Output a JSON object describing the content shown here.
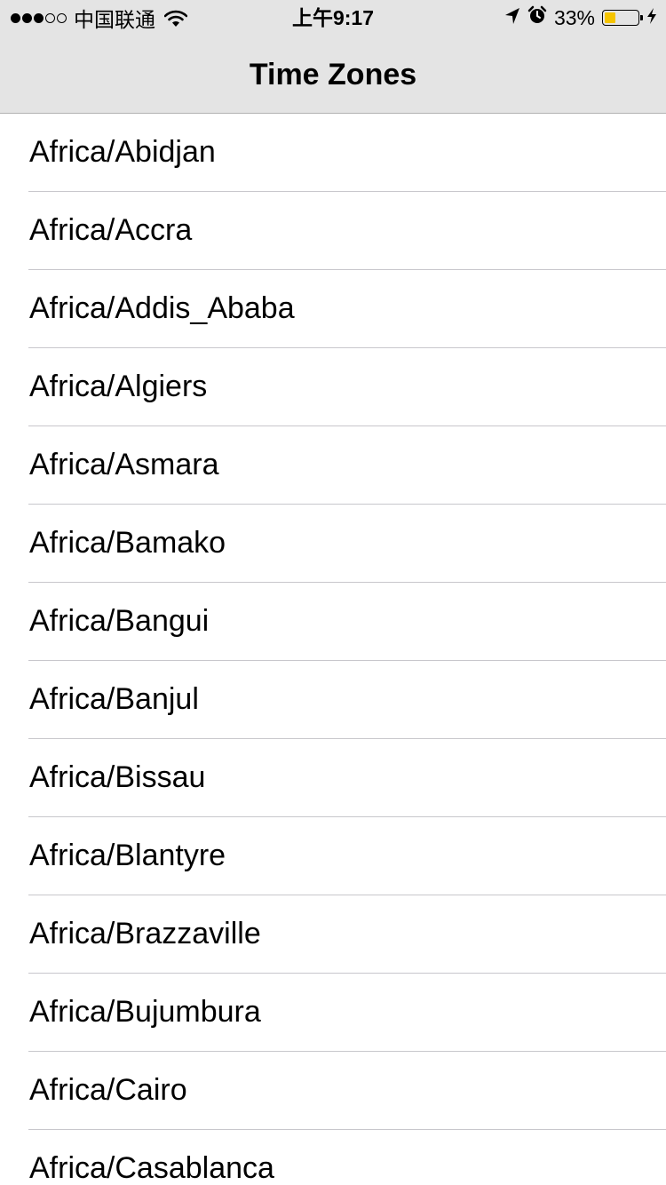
{
  "status_bar": {
    "carrier": "中国联通",
    "time": "上午9:17",
    "battery_percent": "33%",
    "battery_level": 0.33,
    "battery_color": "#f5c400",
    "signal_bars_filled": 3,
    "signal_bars_total": 5,
    "icons": [
      "wifi-icon",
      "location-arrow-icon",
      "alarm-icon",
      "charging-bolt-icon"
    ]
  },
  "nav": {
    "title": "Time Zones"
  },
  "time_zones": [
    "Africa/Abidjan",
    "Africa/Accra",
    "Africa/Addis_Ababa",
    "Africa/Algiers",
    "Africa/Asmara",
    "Africa/Bamako",
    "Africa/Bangui",
    "Africa/Banjul",
    "Africa/Bissau",
    "Africa/Blantyre",
    "Africa/Brazzaville",
    "Africa/Bujumbura",
    "Africa/Cairo",
    "Africa/Casablanca"
  ]
}
